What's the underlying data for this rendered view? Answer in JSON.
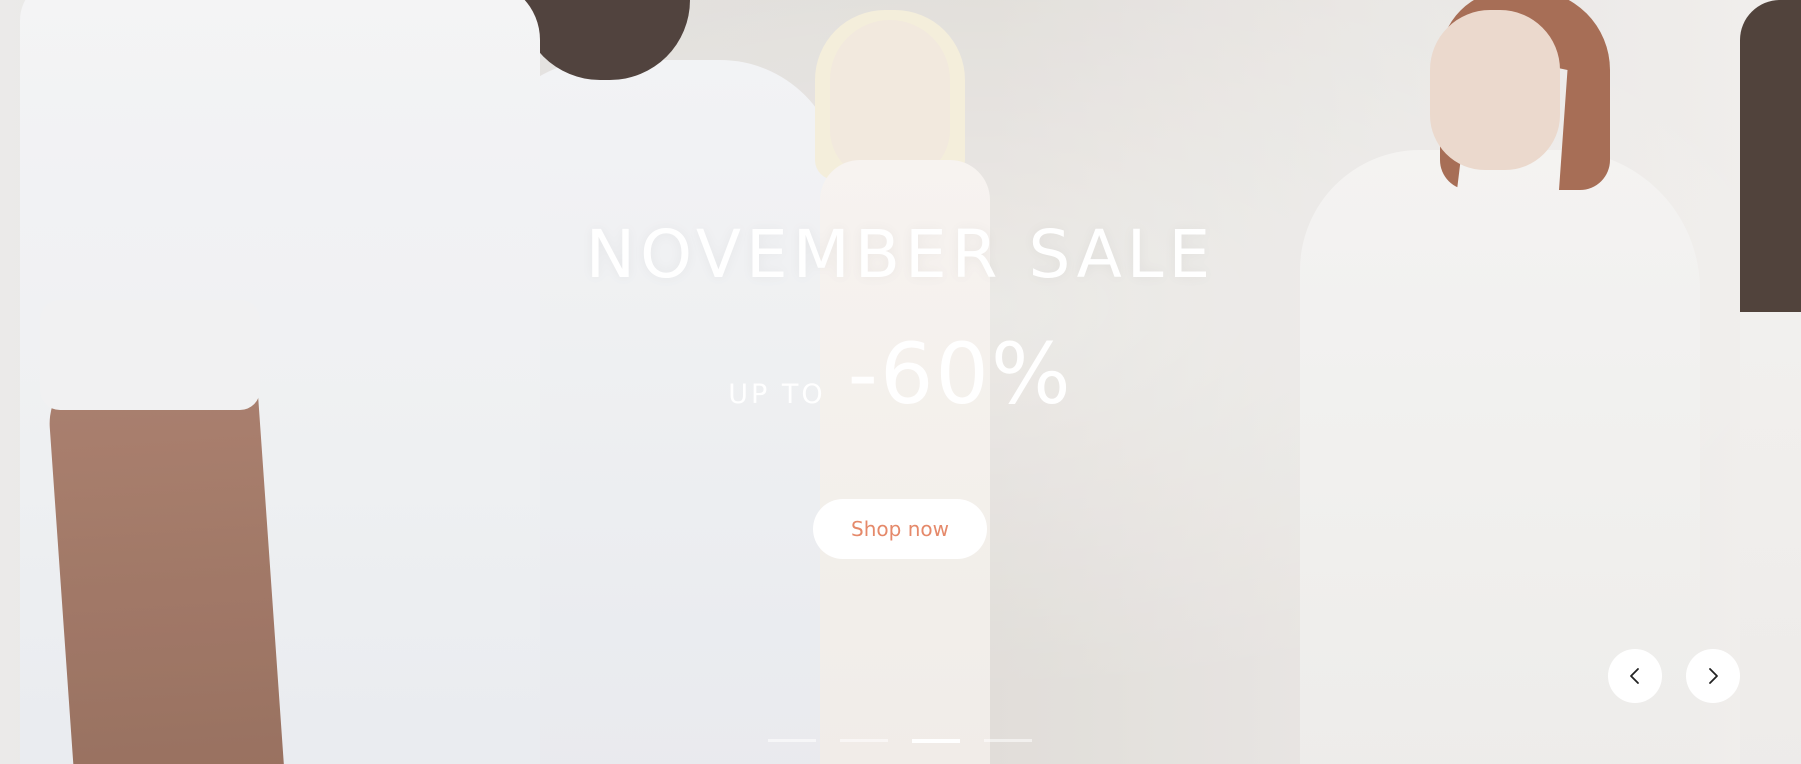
{
  "hero": {
    "headline": "NOVEMBER SALE",
    "prefix": "UP TO",
    "discount": "-60%",
    "cta_label": "Shop now",
    "cta_color": "#e5896a"
  },
  "carousel": {
    "prev_icon": "chevron-left-icon",
    "next_icon": "chevron-right-icon",
    "slide_count": 4,
    "active_index": 2
  }
}
